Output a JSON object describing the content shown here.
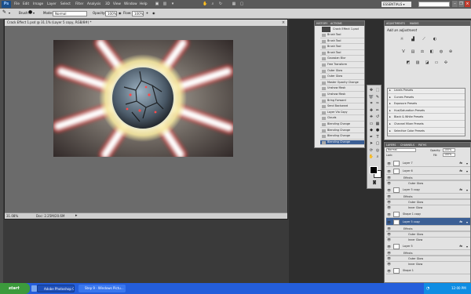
{
  "menubar": {
    "logo": "Ps",
    "items": [
      "File",
      "Edit",
      "Image",
      "Layer",
      "Select",
      "Filter",
      "Analysis",
      "3D",
      "View",
      "Window",
      "Help"
    ],
    "workspace": "ESSENTIALS ▾"
  },
  "optbar": {
    "brush_label": "Brush:",
    "mode_label": "Mode:",
    "mode_value": "Normal",
    "opacity_label": "Opacity:",
    "opacity_value": "100%",
    "flow_label": "Flow:",
    "flow_value": "100%"
  },
  "document": {
    "title": "Crack Effect 1.psd @ 31.1% (Layer 5 copy, RGB/8#) *",
    "zoom": "31.08%",
    "doc_size": "Doc: 2.25M/20.6M"
  },
  "history": {
    "tabs": [
      "HISTORY",
      "ACTIONS"
    ],
    "snapshot": "Crack Effect 1.psd",
    "items": [
      "Brush Tool",
      "Brush Tool",
      "Brush Tool",
      "Brush Tool",
      "Gaussian Blur",
      "Free Transform",
      "Outer Glow",
      "Outer Glow",
      "Master Opacity Change",
      "Unshow Mask",
      "Unshow Mask",
      "Bring Forward",
      "Send Backward",
      "Layer Via Copy",
      "Clouds",
      "Blending Change",
      "Blending Change",
      "Blending Change",
      "Blending Change"
    ]
  },
  "adjustments": {
    "tabs": [
      "ADJUSTMENTS",
      "MASKS"
    ],
    "heading": "Add an adjustment",
    "presets": [
      "Levels Presets",
      "Curves Presets",
      "Exposure Presets",
      "Hue/Saturation Presets",
      "Black & White Presets",
      "Channel Mixer Presets",
      "Selective Color Presets"
    ]
  },
  "layers": {
    "tabs": [
      "LAYERS",
      "CHANNELS",
      "PATHS"
    ],
    "blend": "Normal",
    "opacity_label": "Opacity:",
    "opacity_value": "100%",
    "lock_label": "Lock:",
    "fill_label": "Fill:",
    "fill_value": "100%",
    "rows": [
      {
        "kind": "main",
        "name": "Layer 7",
        "fx": "fx",
        "selected": false
      },
      {
        "kind": "main",
        "name": "Layer 6",
        "fx": "fx",
        "selected": false
      },
      {
        "kind": "fxh",
        "name": "Effects"
      },
      {
        "kind": "eff",
        "name": "Outer Glow"
      },
      {
        "kind": "main",
        "name": "Layer 5 copy",
        "fx": "fx",
        "selected": false
      },
      {
        "kind": "fxh",
        "name": "Effects"
      },
      {
        "kind": "eff",
        "name": "Outer Glow"
      },
      {
        "kind": "eff",
        "name": "Inner Glow"
      },
      {
        "kind": "main",
        "name": "Shape 1 copy",
        "fx": "",
        "selected": false
      },
      {
        "kind": "main",
        "name": "Layer 5 copy",
        "fx": "fx",
        "selected": true
      },
      {
        "kind": "fxh",
        "name": "Effects"
      },
      {
        "kind": "eff",
        "name": "Outer Glow"
      },
      {
        "kind": "eff",
        "name": "Inner Glow"
      },
      {
        "kind": "main",
        "name": "Layer 5",
        "fx": "fx",
        "selected": false
      },
      {
        "kind": "fxh",
        "name": "Effects"
      },
      {
        "kind": "eff",
        "name": "Outer Glow"
      },
      {
        "kind": "eff",
        "name": "Inner Glow"
      },
      {
        "kind": "main",
        "name": "Shape 1",
        "fx": "",
        "selected": false
      }
    ]
  },
  "taskbar": {
    "start": "start",
    "tasks": [
      "Adobe Photoshop CS4 ...",
      "Step 9 - Windows Pictu..."
    ],
    "clock": "12:00 PM"
  },
  "colors": {
    "accent": "#3b5f95",
    "taskbar": "#245edb"
  }
}
